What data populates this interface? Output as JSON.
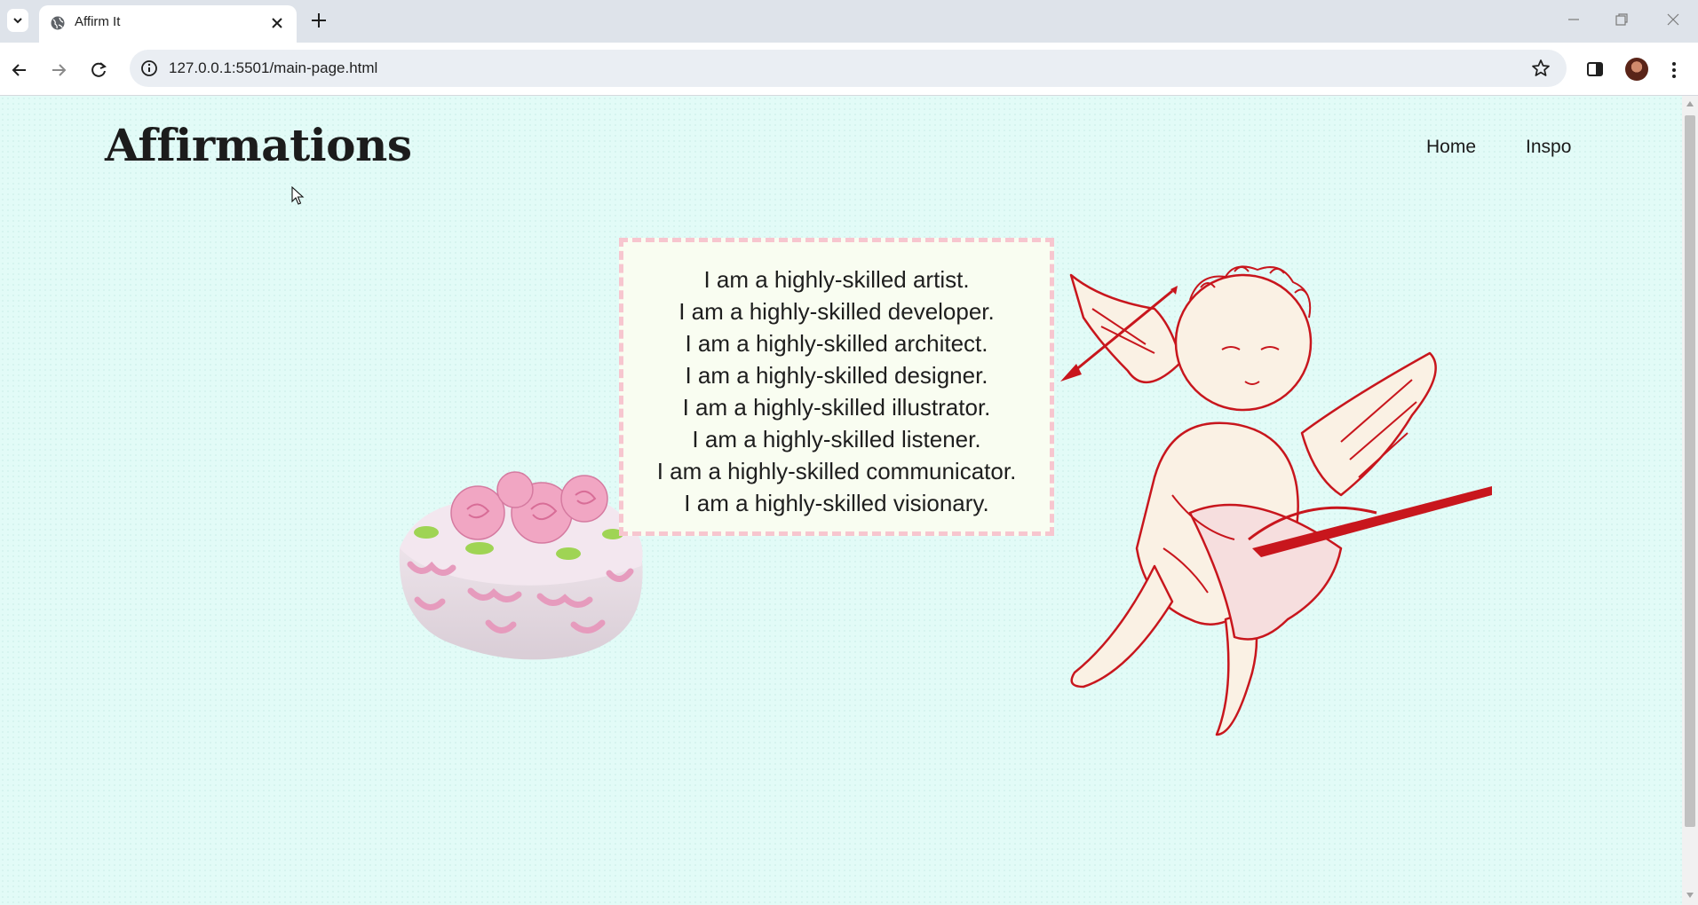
{
  "browser": {
    "tab_title": "Affirm It",
    "url": "127.0.0.1:5501/main-page.html"
  },
  "site": {
    "title": "Affirmations",
    "nav": [
      {
        "label": "Home"
      },
      {
        "label": "Inspo"
      }
    ]
  },
  "affirmations": [
    "I am a highly-skilled artist.",
    "I am a highly-skilled developer.",
    "I am a highly-skilled architect.",
    "I am a highly-skilled designer.",
    "I am a highly-skilled illustrator.",
    "I am a highly-skilled listener.",
    "I am a highly-skilled communicator.",
    "I am a highly-skilled visionary."
  ],
  "colors": {
    "page_background": "#e2fbf7",
    "box_border": "#f7c6cf",
    "box_background": "#f9fdf1",
    "cupid_red": "#c8161d",
    "cake_pink": "#ec9ab8"
  },
  "icons": [
    "tab-search-icon",
    "globe-icon",
    "close-icon",
    "plus-icon",
    "minimize-icon",
    "restore-icon",
    "close-window-icon",
    "back-arrow-icon",
    "forward-arrow-icon",
    "reload-icon",
    "site-info-icon",
    "bookmark-star-icon",
    "side-panel-icon",
    "profile-avatar",
    "menu-dots-icon",
    "mouse-cursor-icon"
  ]
}
